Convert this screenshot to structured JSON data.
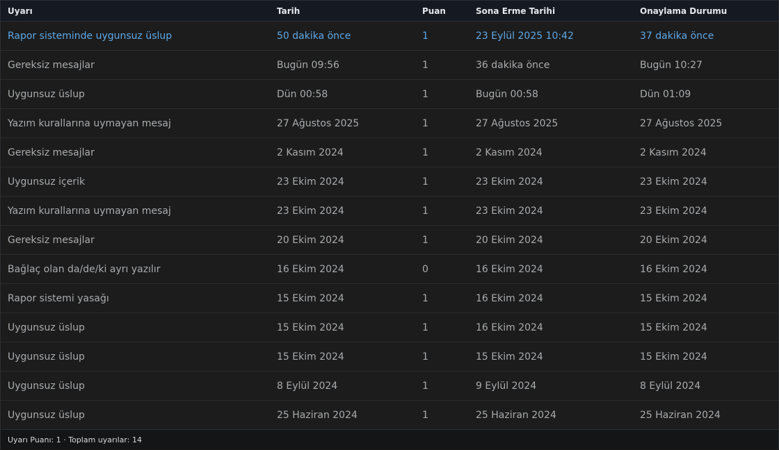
{
  "table": {
    "headers": [
      "Uyarı",
      "Tarih",
      "Puan",
      "Sona Erme Tarihi",
      "Onaylama Durumu"
    ],
    "rows": [
      [
        "Rapor sisteminde uygunsuz üslup",
        "50 dakika önce",
        "1",
        "23 Eylül 2025 10:42",
        "37 dakika önce"
      ],
      [
        "Gereksiz mesajlar",
        "Bugün 09:56",
        "1",
        "36 dakika önce",
        "Bugün 10:27"
      ],
      [
        "Uygunsuz üslup",
        "Dün 00:58",
        "1",
        "Bugün 00:58",
        "Dün 01:09"
      ],
      [
        "Yazım kurallarına uymayan mesaj",
        "27 Ağustos 2025",
        "1",
        "27 Ağustos 2025",
        "27 Ağustos 2025"
      ],
      [
        "Gereksiz mesajlar",
        "2 Kasım 2024",
        "1",
        "2 Kasım 2024",
        "2 Kasım 2024"
      ],
      [
        "Uygunsuz içerik",
        "23 Ekim 2024",
        "1",
        "23 Ekim 2024",
        "23 Ekim 2024"
      ],
      [
        "Yazım kurallarına uymayan mesaj",
        "23 Ekim 2024",
        "1",
        "23 Ekim 2024",
        "23 Ekim 2024"
      ],
      [
        "Gereksiz mesajlar",
        "20 Ekim 2024",
        "1",
        "20 Ekim 2024",
        "20 Ekim 2024"
      ],
      [
        "Bağlaç olan da/de/ki ayrı yazılır",
        "16 Ekim 2024",
        "0",
        "16 Ekim 2024",
        "16 Ekim 2024"
      ],
      [
        "Rapor sistemi yasağı",
        "15 Ekim 2024",
        "1",
        "16 Ekim 2024",
        "15 Ekim 2024"
      ],
      [
        "Uygunsuz üslup",
        "15 Ekim 2024",
        "1",
        "16 Ekim 2024",
        "15 Ekim 2024"
      ],
      [
        "Uygunsuz üslup",
        "15 Ekim 2024",
        "1",
        "15 Ekim 2024",
        "15 Ekim 2024"
      ],
      [
        "Uygunsuz üslup",
        "8 Eylül 2024",
        "1",
        "9 Eylül 2024",
        "8 Eylül 2024"
      ],
      [
        "Uygunsuz üslup",
        "25 Haziran 2024",
        "1",
        "25 Haziran 2024",
        "25 Haziran 2024"
      ]
    ],
    "highlighted_row": 0,
    "summary": "Uyarı Puanı: 1 · Toplam uyarılar: 14"
  },
  "colors": {
    "active_row_text": "#5ea8e6",
    "row_text": "#a9abae",
    "header_text": "#e4e6eb"
  }
}
